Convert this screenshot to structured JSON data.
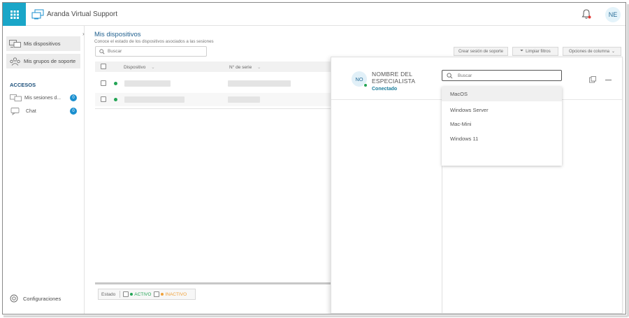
{
  "header": {
    "brand": "Aranda Virtual Support",
    "user_initials": "NE"
  },
  "sidebar": {
    "items": [
      {
        "label": "Mis dispositivos",
        "icon": "devices-icon"
      },
      {
        "label": "Mis grupos de soporte",
        "icon": "support-groups-icon"
      }
    ],
    "accesos_title": "ACCESOS",
    "accesos": [
      {
        "label": "Mis sesiones d...",
        "badge": "0"
      },
      {
        "label": "Chat",
        "badge": "0"
      }
    ],
    "config_label": "Configuraciones"
  },
  "main": {
    "title": "Mis dispositivos",
    "subtitle": "Conoce el estado de los dispositivos asociados a las sesiones",
    "search_placeholder": "Buscar",
    "buttons": {
      "create": "Crear sesión de soporte",
      "clear": "Limpiar filtros",
      "columns": "Opciones de columna"
    },
    "columns": [
      "Dispositivo",
      "N° de serie"
    ],
    "legend": {
      "label": "Estado",
      "active": "ACTIVO",
      "inactive": "INACTIVO",
      "active_color": "#23a455",
      "inactive_color": "#f0a13a"
    }
  },
  "panel": {
    "avatar": "NO",
    "specialist_name": "NOMBRE DEL ESPECIALISTA",
    "status": "Conectado",
    "search_placeholder": "Buscar",
    "options": [
      "MacOS",
      "Windows Server",
      "Mac-Mini",
      "Windows 11"
    ]
  },
  "colors": {
    "accent": "#1aa6c8",
    "title": "#1f5f8e",
    "badge": "#1a8fcf"
  }
}
